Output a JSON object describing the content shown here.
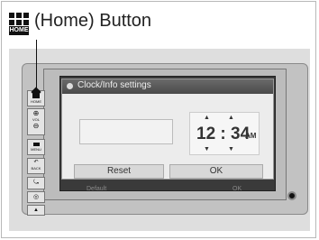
{
  "heading": {
    "icon_label": "HOME",
    "title": "(Home) Button"
  },
  "dialog": {
    "title": "Clock/Info settings",
    "time": "12 : 34",
    "ampm": "AM",
    "reset_label": "Reset",
    "ok_label": "OK",
    "ghost_left": "Default",
    "ghost_right": "OK"
  },
  "side_buttons": {
    "home": "HOME",
    "vol": "VOL",
    "menu": "MENU",
    "back": "BACK"
  }
}
